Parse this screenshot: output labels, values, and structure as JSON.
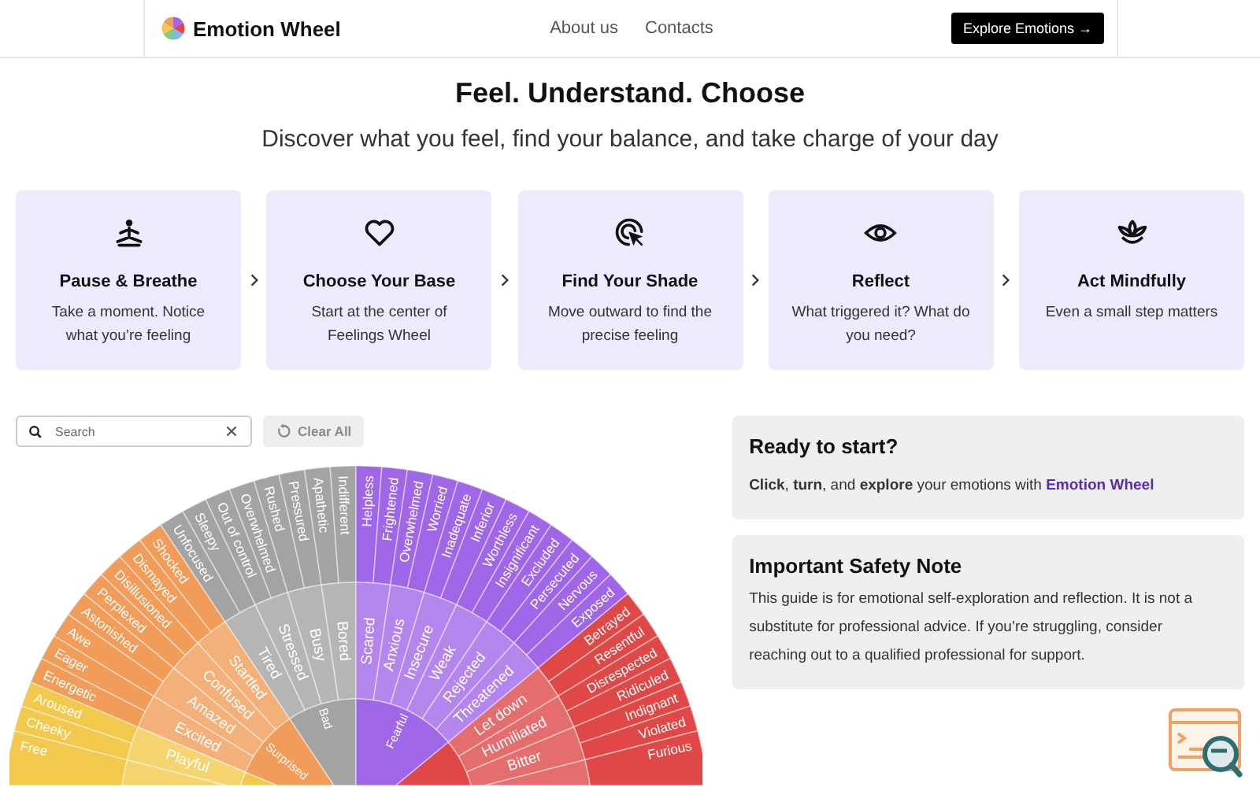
{
  "header": {
    "logo_text": "Emotion Wheel",
    "nav": [
      "About us",
      "Contacts"
    ],
    "cta": "Explore Emotions →"
  },
  "hero": {
    "title": "Feel. Understand. Choose",
    "subtitle": "Discover what you feel, find your balance, and take charge of your day"
  },
  "steps": [
    {
      "title": "Pause & Breathe",
      "text": "Take a moment. Notice what you’re feeling"
    },
    {
      "title": "Choose Your Base",
      "text": "Start at the center of Feelings Wheel"
    },
    {
      "title": "Find Your Shade",
      "text": "Move outward to find the precise feeling"
    },
    {
      "title": "Reflect",
      "text": "What triggered it? What do you need?"
    },
    {
      "title": "Act Mindfully",
      "text": "Even a small step matters"
    }
  ],
  "search": {
    "placeholder": "Search"
  },
  "clear_button": {
    "label": "Clear All",
    "disabled": true
  },
  "wheel": {
    "categories": [
      {
        "color": "#f2c94c",
        "groups": [
          {
            "leaves": [
              "Free"
            ]
          },
          {
            "label": "Playful",
            "leaves": [
              "Cheeky",
              "Aroused"
            ]
          }
        ]
      },
      {
        "color": "#f19c58",
        "label": "Surprised",
        "groups": [
          {
            "label": "Excited",
            "leaves": [
              "Energetic",
              "Eager"
            ]
          },
          {
            "label": "Amazed",
            "leaves": [
              "Awe",
              "Astonished"
            ]
          },
          {
            "label": "Confused",
            "leaves": [
              "Perplexed",
              "Disillusioned"
            ]
          },
          {
            "label": "Startled",
            "leaves": [
              "Dismayed",
              "Shocked"
            ]
          }
        ]
      },
      {
        "color": "#a3a3a3",
        "label": "Bad",
        "groups": [
          {
            "label": "Tired",
            "leaves": [
              "Unfocused",
              "Sleepy"
            ]
          },
          {
            "label": "Stressed",
            "leaves": [
              "Out of control",
              "Overwhelmed"
            ]
          },
          {
            "label": "Busy",
            "leaves": [
              "Rushed",
              "Pressured"
            ]
          },
          {
            "label": "Bored",
            "leaves": [
              "Apathetic",
              "Indifferent"
            ]
          }
        ]
      },
      {
        "color": "#a066e8",
        "label": "Fearful",
        "groups": [
          {
            "label": "Scared",
            "leaves": [
              "Helpless",
              "Frightened"
            ]
          },
          {
            "label": "Anxious",
            "leaves": [
              "Overwhelmed",
              "Worried"
            ]
          },
          {
            "label": "Insecure",
            "leaves": [
              "Inadequate",
              "Inferior"
            ]
          },
          {
            "label": "Weak",
            "leaves": [
              "Worthless",
              "Insignificant"
            ]
          },
          {
            "label": "Rejected",
            "leaves": [
              "Excluded",
              "Persecuted"
            ]
          },
          {
            "label": "Threatened",
            "leaves": [
              "Nervous",
              "Exposed"
            ]
          }
        ]
      },
      {
        "color": "#e04848",
        "groups": [
          {
            "label": "Let down",
            "leaves": [
              "Betrayed",
              "Resentful"
            ]
          },
          {
            "label": "Humiliated",
            "leaves": [
              "Disrespected",
              "Ridiculed"
            ]
          },
          {
            "label": "Bitter",
            "leaves": [
              "Indignant",
              "Violated"
            ]
          },
          {
            "leaves": [
              "Furious"
            ]
          }
        ]
      }
    ]
  },
  "ready": {
    "title": "Ready to start?",
    "text": "**Click**, **turn**, and **explore** your emotions with",
    "link": "Emotion Wheel"
  },
  "safety": {
    "title": "Important Safety Note",
    "text": "This guide is for emotional self-exploration and reflection. It is not a substitute for professional advice. If you’re struggling, consider reaching out to a qualified professional for support."
  }
}
